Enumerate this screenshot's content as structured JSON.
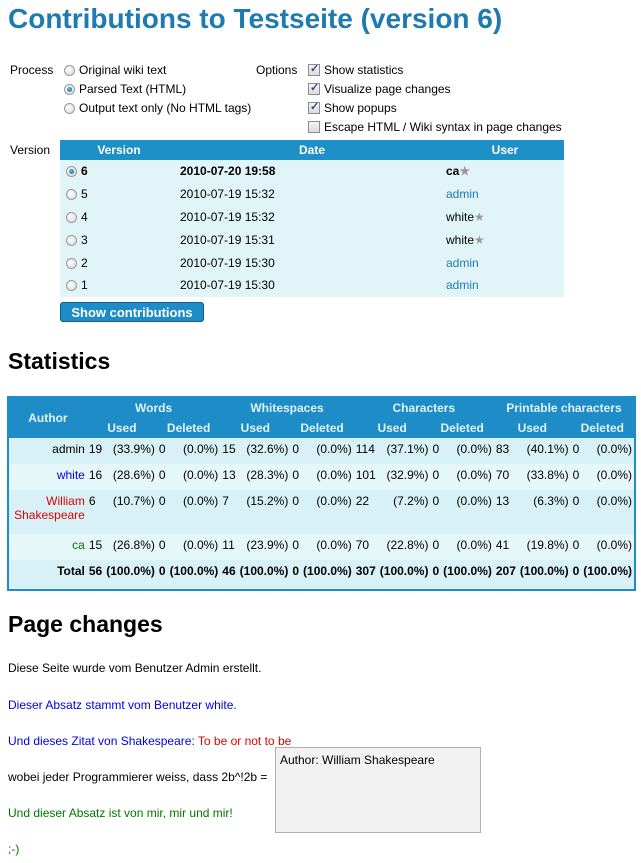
{
  "title": "Contributions to Testseite (version 6)",
  "process": {
    "label": "Process",
    "options": [
      {
        "label": "Original wiki text",
        "selected": false
      },
      {
        "label": "Parsed Text (HTML)",
        "selected": true
      },
      {
        "label": "Output text only (No HTML tags)",
        "selected": false
      }
    ]
  },
  "options": {
    "label": "Options",
    "items": [
      {
        "label": "Show statistics",
        "checked": true
      },
      {
        "label": "Visualize page changes",
        "checked": true
      },
      {
        "label": "Show popups",
        "checked": true
      },
      {
        "label": "Escape HTML / Wiki syntax in page changes",
        "checked": false
      }
    ]
  },
  "versions": {
    "label": "Version",
    "headers": [
      "Version",
      "Date",
      "User"
    ],
    "rows": [
      {
        "version": "6",
        "date": "2010-07-20 19:58",
        "user": "ca",
        "star": true,
        "link": false,
        "selected": true
      },
      {
        "version": "5",
        "date": "2010-07-19 15:32",
        "user": "admin",
        "star": false,
        "link": true,
        "selected": false
      },
      {
        "version": "4",
        "date": "2010-07-19 15:32",
        "user": "white",
        "star": true,
        "link": false,
        "selected": false
      },
      {
        "version": "3",
        "date": "2010-07-19 15:31",
        "user": "white",
        "star": true,
        "link": false,
        "selected": false
      },
      {
        "version": "2",
        "date": "2010-07-19 15:30",
        "user": "admin",
        "star": false,
        "link": true,
        "selected": false
      },
      {
        "version": "1",
        "date": "2010-07-19 15:30",
        "user": "admin",
        "star": false,
        "link": true,
        "selected": false
      }
    ],
    "star_glyph": "★",
    "button_label": "Show contributions"
  },
  "statistics": {
    "heading": "Statistics",
    "author_header": "Author",
    "groups": [
      "Words",
      "Whitespaces",
      "Characters",
      "Printable characters"
    ],
    "subheaders": [
      "Used",
      "Deleted"
    ],
    "rows": [
      {
        "author": "admin",
        "color": "#000000",
        "cells": [
          "19",
          "(33.9%)",
          "0",
          "(0.0%)",
          "15",
          "(32.6%)",
          "0",
          "(0.0%)",
          "114",
          "(37.1%)",
          "0",
          "(0.0%)",
          "83",
          "(40.1%)",
          "0",
          "(0.0%)"
        ]
      },
      {
        "author": "white",
        "color": "#0000dd",
        "cells": [
          "16",
          "(28.6%)",
          "0",
          "(0.0%)",
          "13",
          "(28.3%)",
          "0",
          "(0.0%)",
          "101",
          "(32.9%)",
          "0",
          "(0.0%)",
          "70",
          "(33.8%)",
          "0",
          "(0.0%)"
        ]
      },
      {
        "author": "William Shakespeare",
        "color": "#e00000",
        "cells": [
          "6",
          "(10.7%)",
          "0",
          "(0.0%)",
          "7",
          "(15.2%)",
          "0",
          "(0.0%)",
          "22",
          "(7.2%)",
          "0",
          "(0.0%)",
          "13",
          "(6.3%)",
          "0",
          "(0.0%)"
        ]
      },
      {
        "author": "ca",
        "color": "#007700",
        "cells": [
          "15",
          "(26.8%)",
          "0",
          "(0.0%)",
          "11",
          "(23.9%)",
          "0",
          "(0.0%)",
          "70",
          "(22.8%)",
          "0",
          "(0.0%)",
          "41",
          "(19.8%)",
          "0",
          "(0.0%)"
        ]
      }
    ],
    "total": {
      "author": "Total",
      "cells": [
        "56",
        "(100.0%)",
        "0",
        "(100.0%)",
        "46",
        "(100.0%)",
        "0",
        "(100.0%)",
        "307",
        "(100.0%)",
        "0",
        "(100.0%)",
        "207",
        "(100.0%)",
        "0",
        "(100.0%)"
      ]
    }
  },
  "page_changes": {
    "heading": "Page changes",
    "lines": [
      [
        {
          "text": "Diese Seite wurde vom Benutzer Admin erstellt.",
          "color": "#000000"
        }
      ],
      [
        {
          "text": "Dieser Absatz stammt vom Benutzer white.",
          "color": "#0000dd"
        }
      ],
      [
        {
          "text": "Und dieses Zitat von Shakespeare: ",
          "color": "#0000dd"
        },
        {
          "text": "To be or not to be",
          "color": "#e00000"
        }
      ],
      [
        {
          "text": "wobei jeder Programmierer weiss, dass 2b^!2b = ",
          "color": "#000000"
        }
      ],
      [
        {
          "text": "Und dieser Absatz ist von mir, mir und mir!",
          "color": "#007700"
        }
      ],
      [
        {
          "text": ";-)",
          "color": "#007700"
        }
      ]
    ],
    "popup": "Author: William Shakespeare"
  },
  "colors": {
    "accent": "#1e8cc6",
    "title": "#1e7ab0",
    "row_bg": "#e1f5f9"
  }
}
